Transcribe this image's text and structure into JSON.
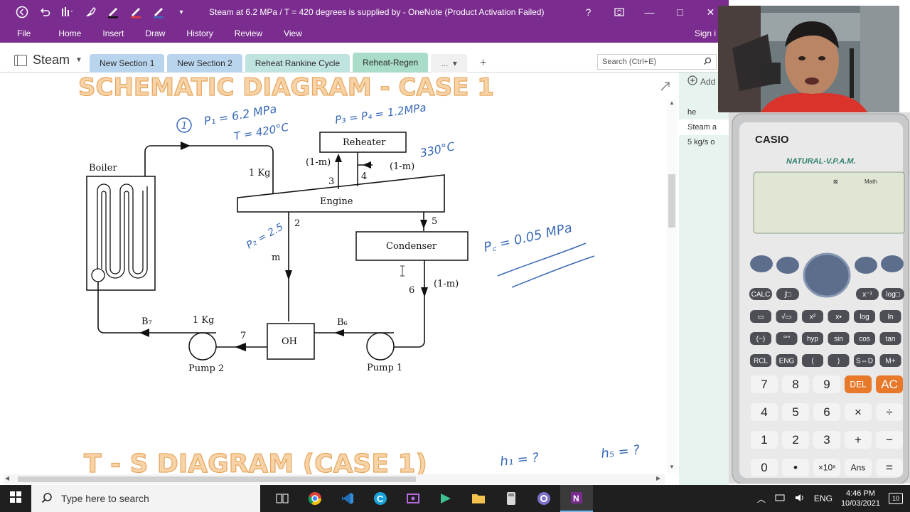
{
  "window": {
    "title": "Steam at 6.2 MPa / T = 420 degrees is supplied by  - OneNote (Product Activation Failed)",
    "help": "?",
    "minimize": "—",
    "maximize": "□",
    "close": "✕"
  },
  "ribbon": {
    "tabs": [
      "File",
      "Home",
      "Insert",
      "Draw",
      "History",
      "Review",
      "View"
    ],
    "signin": "Sign i"
  },
  "notebook": {
    "name": "Steam"
  },
  "sections": {
    "tabs": [
      "New Section 1",
      "New Section 2",
      "Reheat Rankine Cycle",
      "Reheat-Regen"
    ],
    "more": "...",
    "add": "+"
  },
  "search": {
    "placeholder": "Search (Ctrl+E)"
  },
  "pages": {
    "add": "Add",
    "items": [
      "he",
      "Steam a",
      "5 kg/s o"
    ]
  },
  "note": {
    "heading1": "SCHEMATIC DIAGRAM - CASE 1",
    "heading2": "T - S DIAGRAM (CASE 1)",
    "diagram": {
      "boiler": "Boiler",
      "reheater": "Reheater",
      "engine": "Engine",
      "condenser": "Condenser",
      "oh": "OH",
      "pump1": "Pump 1",
      "pump2": "Pump 2",
      "kg1": "1 Kg",
      "kg2": "1 Kg",
      "m": "m",
      "one_m_left": "(1-m)",
      "one_m_right": "(1-m)",
      "one_m_cond": "(1-m)",
      "n2": "2",
      "n3": "3",
      "n4": "4",
      "n5": "5",
      "n6": "6",
      "n7": "7",
      "b7": "B₇",
      "b6": "B₆"
    },
    "handwriting": {
      "state1": "1",
      "p1": "P₁ = 6.2 MPa",
      "t1": "T = 420°C",
      "p3": "P₃ = P₄ = 1.2MPa",
      "t4": "330°C",
      "p2": "P₂ = 2.5",
      "pc": "P꜀ = 0.05 MPa",
      "h1": "h₁ = ?",
      "h5": "h₅ = ?"
    }
  },
  "calculator": {
    "brand": "CASIO",
    "model": "NATURAL-V.P.A.M.",
    "display": "Math",
    "keys_row1": [
      "CALC",
      "∫□",
      "x⁻¹",
      "log□"
    ],
    "keys_row2": [
      "▭",
      "√▭",
      "x²",
      "x▪",
      "log",
      "ln"
    ],
    "keys_row3": [
      "(−)",
      "°'\"",
      "hyp",
      "sin",
      "cos",
      "tan"
    ],
    "keys_row4": [
      "RCL",
      "ENG",
      "(",
      ")",
      "S⇔D",
      "M+"
    ],
    "keys_num1": [
      "7",
      "8",
      "9",
      "DEL",
      "AC"
    ],
    "keys_num2": [
      "4",
      "5",
      "6",
      "×",
      "÷"
    ],
    "keys_num3": [
      "1",
      "2",
      "3",
      "+",
      "−"
    ],
    "keys_num4": [
      "0",
      "•",
      "×10ˣ",
      "Ans",
      "="
    ]
  },
  "taskbar": {
    "search_placeholder": "Type here to search",
    "lang": "ENG",
    "time": "4:46 PM",
    "date": "10/03/2021",
    "notifications": "10"
  },
  "colors": {
    "onenote_purple": "#7b2d8f",
    "section_active": "#a9dcc9",
    "ink_blue": "#3a6ab8",
    "heading_orange": "#e8a45c",
    "calc_del": "#e8782a"
  }
}
